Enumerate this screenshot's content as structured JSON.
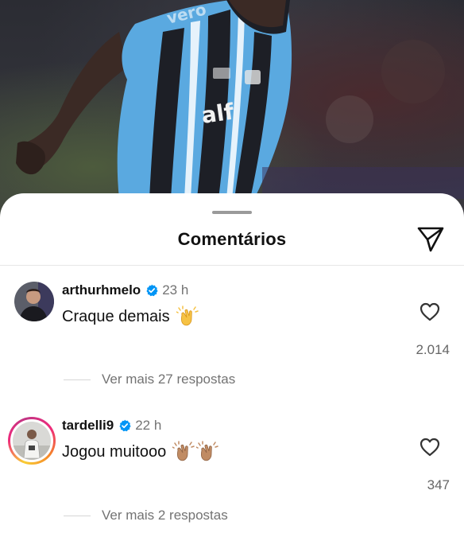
{
  "sheet": {
    "title": "Comentários",
    "send_icon": "paper-plane-icon"
  },
  "comments": [
    {
      "username": "arthurhmelo",
      "verified": true,
      "time": "23 h",
      "text": "Craque demais",
      "emoji": "clapping-hands",
      "likes": "2.014",
      "more_replies": "Ver mais 27 respostas"
    },
    {
      "username": "tardelli9",
      "verified": true,
      "time": "22 h",
      "text": "Jogou muitooo",
      "emoji": "clapping-hands x2",
      "likes": "347",
      "more_replies": "Ver mais 2 respostas"
    }
  ],
  "colors": {
    "verified_blue": "#0095f6",
    "jersey_blue": "#5aa9e0",
    "text_primary": "#111111",
    "text_secondary": "#737373"
  }
}
